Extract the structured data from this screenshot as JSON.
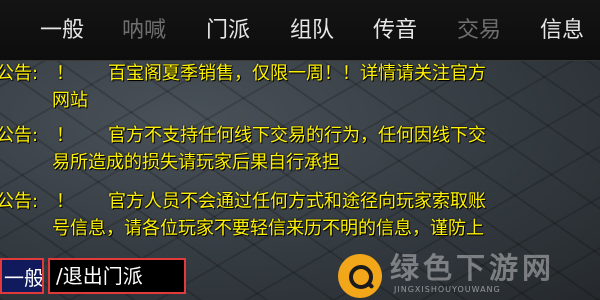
{
  "tabs": [
    {
      "label": "一般",
      "enabled": true
    },
    {
      "label": "呐喊",
      "enabled": false
    },
    {
      "label": "门派",
      "enabled": true
    },
    {
      "label": "组队",
      "enabled": true
    },
    {
      "label": "传音",
      "enabled": true
    },
    {
      "label": "交易",
      "enabled": false
    },
    {
      "label": "信息",
      "enabled": true
    }
  ],
  "messages": [
    {
      "prefix": "公告:",
      "bang": "！",
      "line1": "百宝阁夏季销售，仅限一周！！详情请关注官方",
      "line2": "网站"
    },
    {
      "prefix": "公告:",
      "bang": "！",
      "line1": "官方不支持任何线下交易的行为，任何因线下交",
      "line2": "易所造成的损失请玩家后果自行承担"
    },
    {
      "prefix": "公告:",
      "bang": "！",
      "line1": "官方人员不会通过任何方式和途径向玩家索取账",
      "line2": "号信息，请各位玩家不要轻信来历不明的信息，谨防上"
    }
  ],
  "input_bar": {
    "channel_label": "一般",
    "input_value": "/退出门派"
  },
  "watermark": {
    "text": "绿色下游网",
    "subtext": "JINGXISHOUYOUWANG"
  },
  "colors": {
    "announcement_text": "#fff200",
    "tab_enabled": "#e6e6e6",
    "tab_disabled": "#6e6e6e",
    "highlight_border": "#e23a3a",
    "channel_bg": "#101a5c",
    "watermark_logo": "#f2a61a"
  }
}
